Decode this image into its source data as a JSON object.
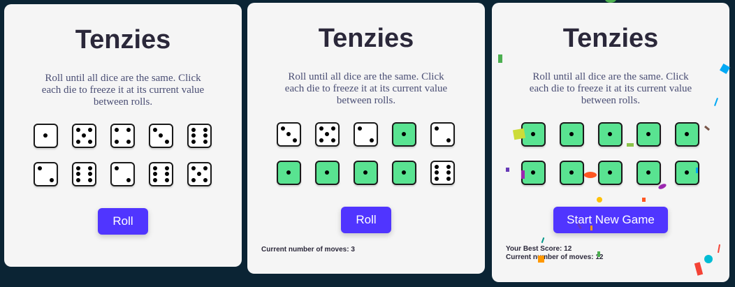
{
  "panels": [
    {
      "title": "Tenzies",
      "instructions": "Roll until all dice are the same. Click each die to freeze it at its current value between rolls.",
      "dice": [
        {
          "value": 1,
          "held": false
        },
        {
          "value": 5,
          "held": false
        },
        {
          "value": 4,
          "held": false
        },
        {
          "value": 3,
          "held": false
        },
        {
          "value": 6,
          "held": false
        },
        {
          "value": 2,
          "held": false
        },
        {
          "value": 6,
          "held": false
        },
        {
          "value": 2,
          "held": false
        },
        {
          "value": 6,
          "held": false
        },
        {
          "value": 5,
          "held": false
        }
      ],
      "button_label": "Roll",
      "stats": []
    },
    {
      "title": "Tenzies",
      "instructions": "Roll until all dice are the same. Click each die to freeze it at its current value between rolls.",
      "dice": [
        {
          "value": 3,
          "held": false
        },
        {
          "value": 5,
          "held": false
        },
        {
          "value": 2,
          "held": false
        },
        {
          "value": 1,
          "held": true
        },
        {
          "value": 2,
          "held": false
        },
        {
          "value": 1,
          "held": true
        },
        {
          "value": 1,
          "held": true
        },
        {
          "value": 1,
          "held": true
        },
        {
          "value": 1,
          "held": true
        },
        {
          "value": 6,
          "held": false
        }
      ],
      "button_label": "Roll",
      "stats": [
        "Current number of moves: 3"
      ]
    },
    {
      "title": "Tenzies",
      "instructions": "Roll until all dice are the same. Click each die to freeze it at its current value between rolls.",
      "dice": [
        {
          "value": 1,
          "held": true
        },
        {
          "value": 1,
          "held": true
        },
        {
          "value": 1,
          "held": true
        },
        {
          "value": 1,
          "held": true
        },
        {
          "value": 1,
          "held": true
        },
        {
          "value": 1,
          "held": true
        },
        {
          "value": 1,
          "held": true
        },
        {
          "value": 1,
          "held": true
        },
        {
          "value": 1,
          "held": true
        },
        {
          "value": 1,
          "held": true
        }
      ],
      "button_label": "Start New Game",
      "stats": [
        "Your Best Score: 12",
        "Current number of moves: 12"
      ]
    }
  ],
  "colors": {
    "page_background": "#0b2434",
    "panel_background": "#f5f5f5",
    "held_die": "#59e391",
    "free_die": "#ffffff",
    "button": "#5035ff",
    "title": "#2b283a",
    "instructions": "#4a4e74"
  }
}
